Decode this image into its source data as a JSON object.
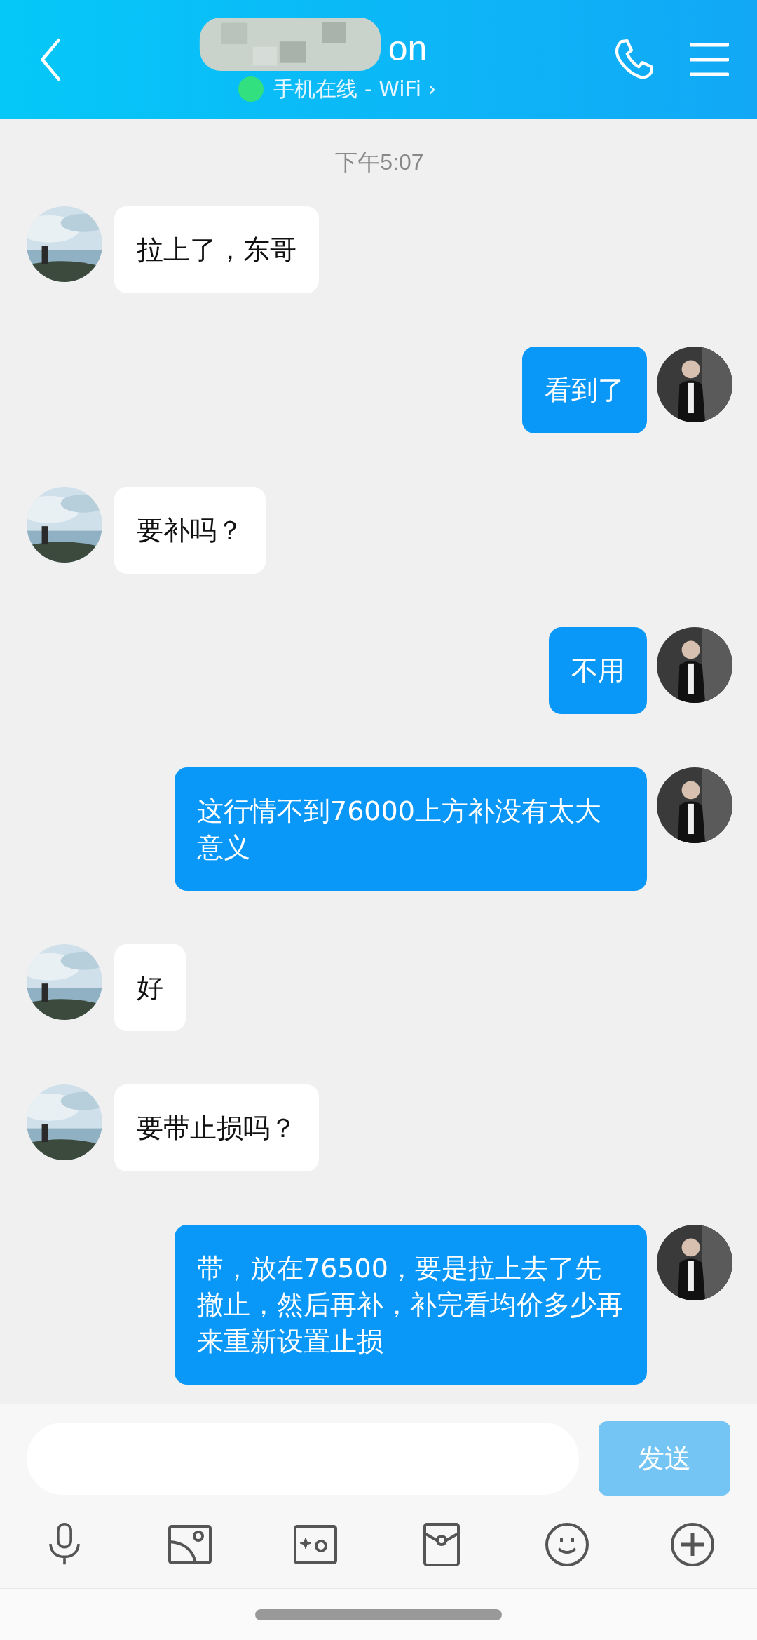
{
  "header": {
    "title": "on",
    "status": "手机在线 - WiFi ›",
    "online": true
  },
  "time": "下午5:07",
  "messages": [
    {
      "kind": "received",
      "text": "拉上了，东哥"
    },
    {
      "kind": "sent",
      "text": "看到了"
    },
    {
      "kind": "received",
      "text": "要补吗？"
    },
    {
      "kind": "sent",
      "text": "不用"
    },
    {
      "kind": "sent",
      "text": "这行情不到76000上方补没有太大意义"
    },
    {
      "kind": "received",
      "text": "好"
    },
    {
      "kind": "received",
      "text": "要带止损吗？"
    },
    {
      "kind": "sent",
      "text": "带，放在76500，要是拉上去了先撤止，然后再补，补完看均价多少再来重新设置止损"
    }
  ],
  "composer": {
    "send": "发送",
    "send_disabled": true
  }
}
